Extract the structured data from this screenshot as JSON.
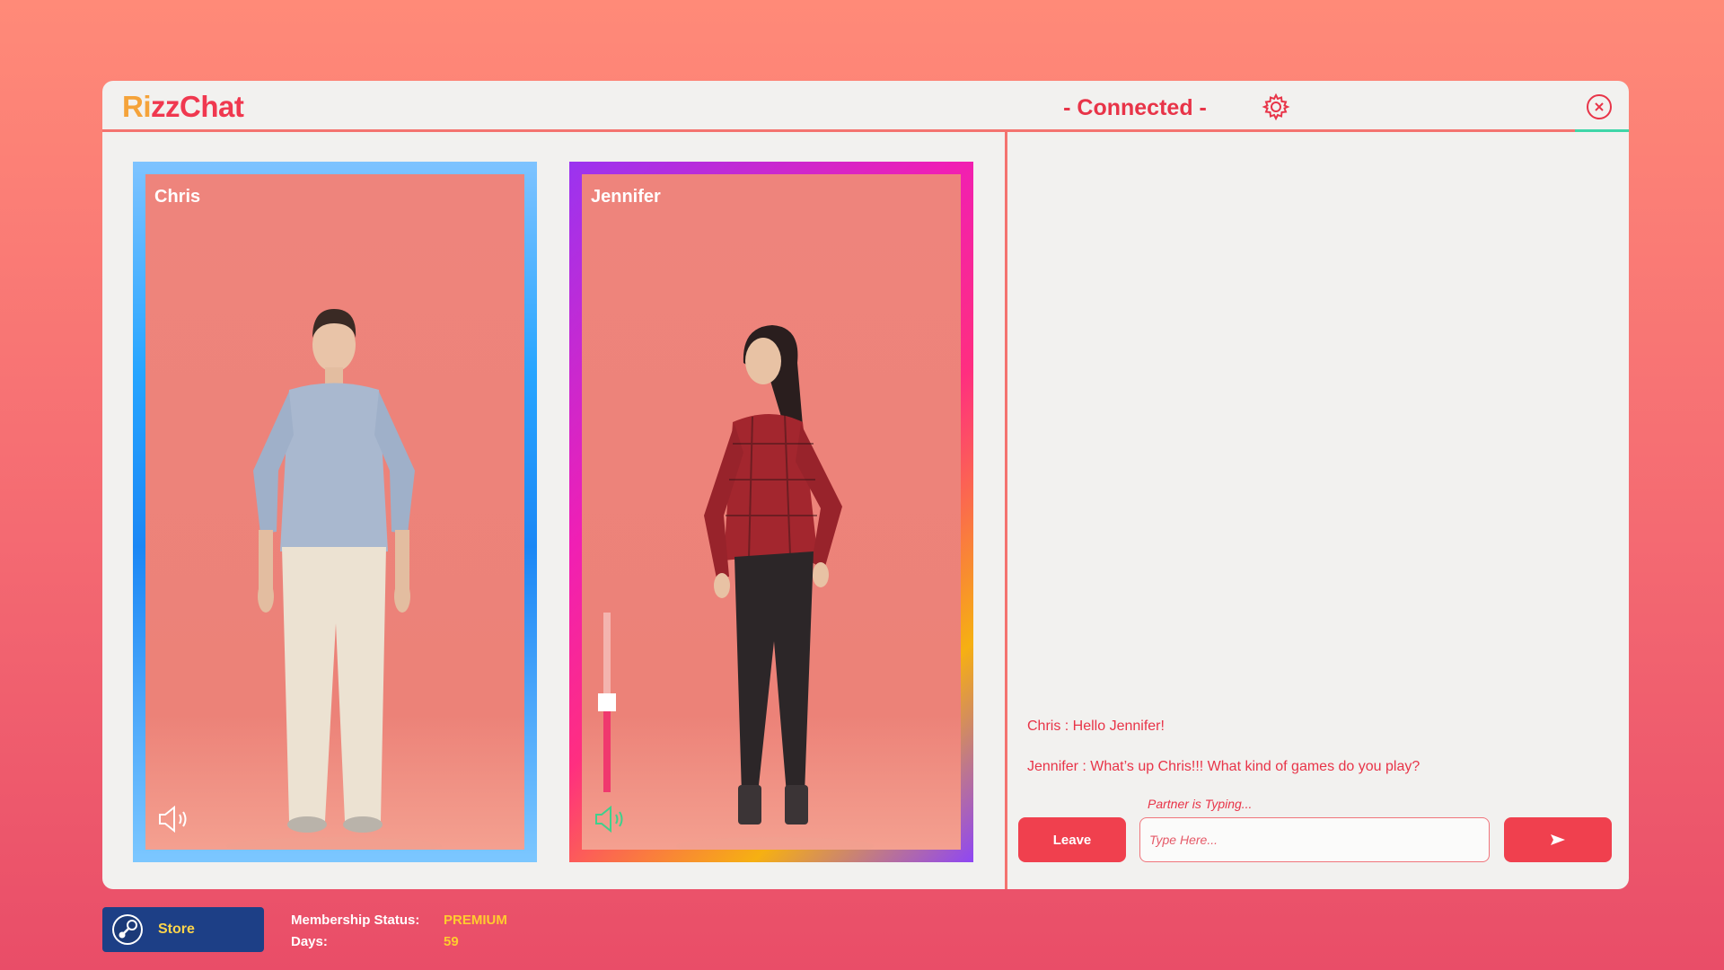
{
  "app": {
    "logo_prefix": "R",
    "logo_i": "i",
    "logo_rest": "zzChat",
    "status": "- Connected -",
    "accent": "#f0384f"
  },
  "titlebar_icons": [
    "gear-icon",
    "close-icon"
  ],
  "cards": [
    {
      "name": "Chris",
      "speaker": "speaker-icon",
      "speaker_active": false
    },
    {
      "name": "Jennifer",
      "speaker": "speaker-icon",
      "speaker_active": true,
      "volume": 0.5
    }
  ],
  "chat": {
    "messages": [
      {
        "text": "Chris : Hello Jennifer!"
      },
      {
        "text": "Jennifer : What’s up Chris!!! What kind of games do you play?"
      }
    ],
    "typing_indicator": "Partner is Typing...",
    "leave_label": "Leave",
    "input_placeholder": "Type Here...",
    "input_value": "",
    "send_icon": "send-arrow-icon"
  },
  "footer": {
    "store_label": "Store",
    "store_icon": "steam-icon",
    "membership_label": "Membership Status:",
    "membership_value": "PREMIUM",
    "days_label": "Days:",
    "days_value": "59"
  }
}
